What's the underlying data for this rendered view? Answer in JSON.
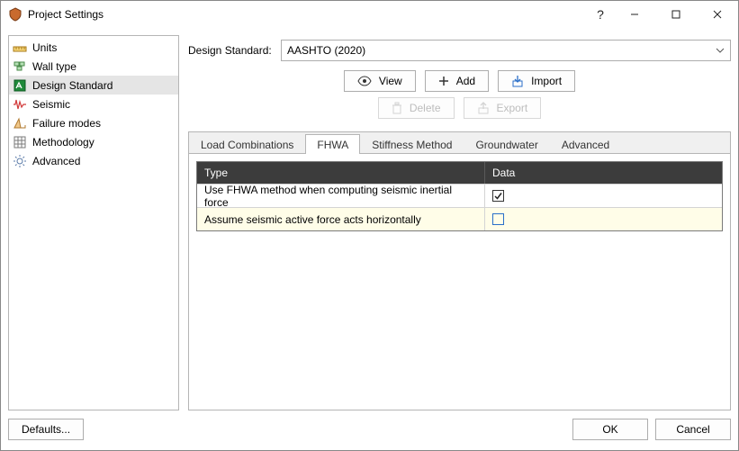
{
  "window": {
    "title": "Project Settings"
  },
  "sidebar": {
    "items": [
      {
        "label": "Units"
      },
      {
        "label": "Wall type"
      },
      {
        "label": "Design Standard"
      },
      {
        "label": "Seismic"
      },
      {
        "label": "Failure modes"
      },
      {
        "label": "Methodology"
      },
      {
        "label": "Advanced"
      }
    ],
    "selected_index": 2
  },
  "design_standard": {
    "label": "Design Standard:",
    "value": "AASHTO (2020)"
  },
  "toolbar": {
    "view": "View",
    "add": "Add",
    "import": "Import",
    "delete": "Delete",
    "export": "Export"
  },
  "tabs": {
    "items": [
      {
        "label": "Load Combinations"
      },
      {
        "label": "FHWA"
      },
      {
        "label": "Stiffness Method"
      },
      {
        "label": "Groundwater"
      },
      {
        "label": "Advanced"
      }
    ],
    "active_index": 1
  },
  "grid": {
    "headers": {
      "type": "Type",
      "data": "Data"
    },
    "rows": [
      {
        "type": "Use FHWA method when computing seismic inertial force",
        "checked": true
      },
      {
        "type": "Assume seismic active force acts horizontally",
        "checked": false
      }
    ]
  },
  "footer": {
    "defaults": "Defaults...",
    "ok": "OK",
    "cancel": "Cancel"
  }
}
